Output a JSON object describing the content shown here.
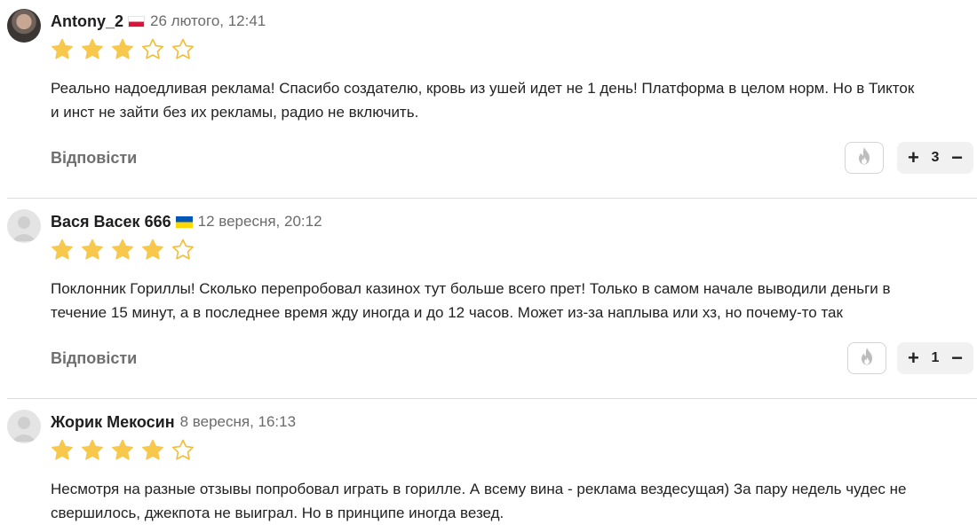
{
  "reviews": [
    {
      "author": "Antony_2",
      "flag": "PL",
      "date": "26 лютого, 12:41",
      "rating": 3,
      "text_lines": [
        "Реально надоедливая реклама! Спасибо создателю, кровь из ушей идет не 1 день! Платформа в целом норм. Но в Тикток",
        "и инст не зайти без их рекламы, радио не включить."
      ],
      "reply_label": "Відповісти",
      "vote_count": "3"
    },
    {
      "author": "Вася Васек 666",
      "flag": "UA",
      "date": "12 вересня, 20:12",
      "rating": 4,
      "text_lines": [
        "Поклонник Гориллы! Сколько перепробовал казинох тут больше всего прет! Только в самом начале выводили деньги в",
        "течение 15 минут,  а в последнее время жду иногда и до 12 часов. Может из-за наплыва или хз, но почему-то так"
      ],
      "reply_label": "Відповісти",
      "vote_count": "1"
    },
    {
      "author": "Жорик Мекосин",
      "flag": "",
      "date": "8 вересня, 16:13",
      "rating": 4,
      "text_lines": [
        "Несмотря на разные отзывы попробовал играть в горилле. А всему вина - реклама вездесущая) За пару недель чудес не",
        "свершилось, джекпота не выиграл. Но в принципе иногда везед."
      ],
      "reply_label": "",
      "vote_count": ""
    }
  ],
  "vote_controls": {
    "plus": "+",
    "minus": "−"
  },
  "colors": {
    "star": "#f7c84b",
    "star_outline": "#f2bd38"
  },
  "icons": {
    "fire": "fire-icon",
    "star": "star-icon",
    "plus": "plus-icon",
    "minus": "minus-icon"
  }
}
